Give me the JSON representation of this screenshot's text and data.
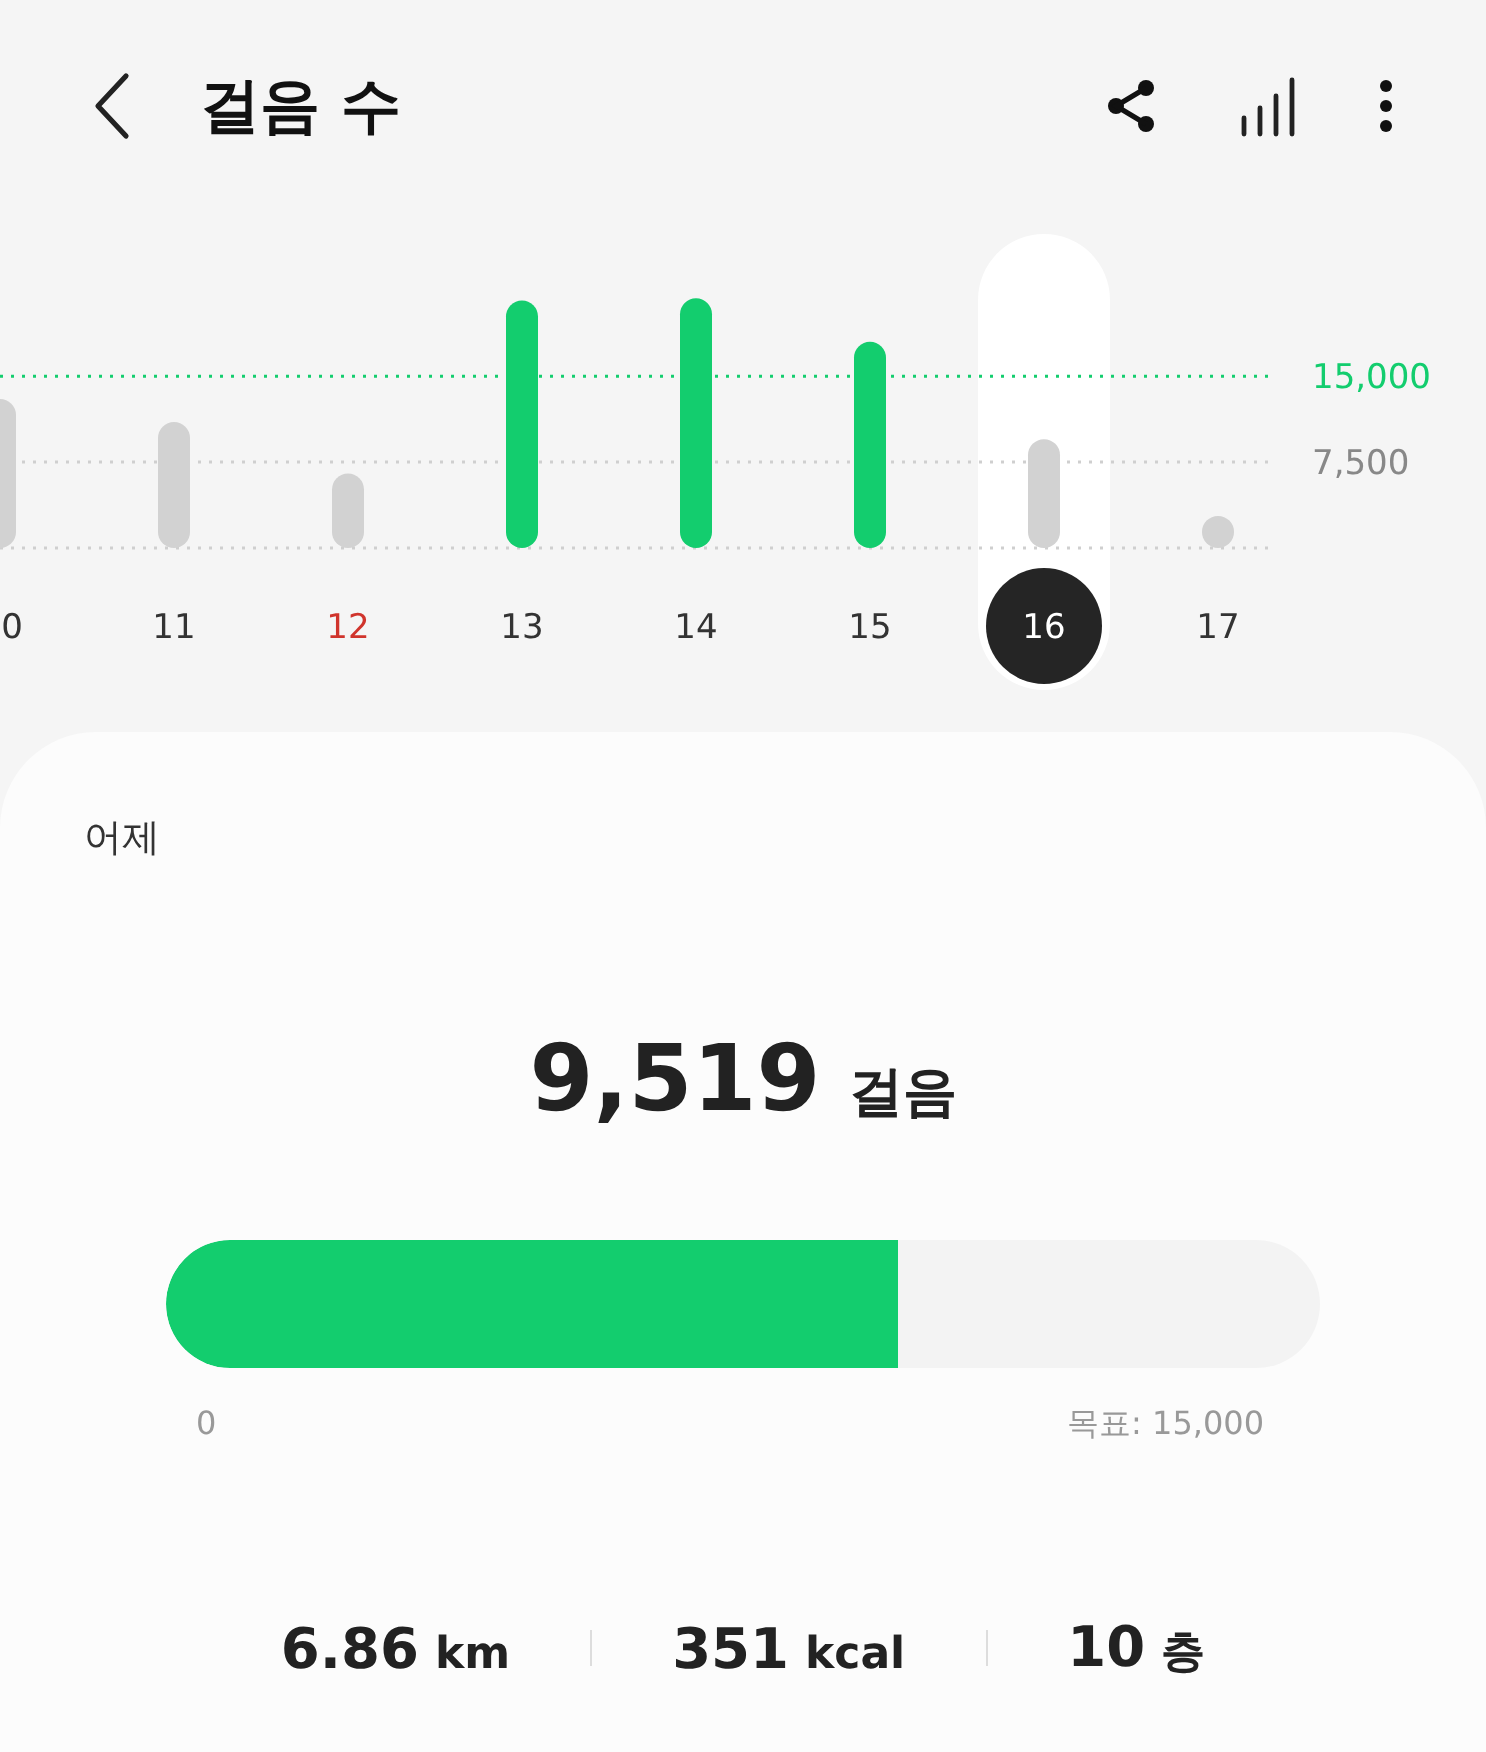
{
  "header": {
    "title": "걸음 수"
  },
  "chart": {
    "chart_data": {
      "type": "bar",
      "categories": [
        "0",
        "11",
        "12",
        "13",
        "14",
        "15",
        "16",
        "17"
      ],
      "series": [
        {
          "color": "#13cd6e",
          "values": [
            null,
            null,
            null,
            21600,
            21800,
            18000,
            null,
            null
          ]
        },
        {
          "color": "#d2d2d2",
          "values": [
            13000,
            11000,
            6500,
            null,
            null,
            null,
            9500,
            2800
          ]
        }
      ],
      "ylim": [
        0,
        22000
      ],
      "yticks": [
        {
          "value": 7500,
          "label": "7,500"
        },
        {
          "value": 15000,
          "label": "15,000"
        }
      ]
    },
    "days": [
      {
        "selected": false,
        "sunday": false
      },
      {
        "selected": false,
        "sunday": false
      },
      {
        "selected": false,
        "sunday": true
      },
      {
        "selected": false,
        "sunday": false
      },
      {
        "selected": false,
        "sunday": false
      },
      {
        "selected": false,
        "sunday": false
      },
      {
        "selected": true,
        "sunday": false
      },
      {
        "selected": false,
        "sunday": false
      }
    ]
  },
  "summary": {
    "day_label": "어제",
    "steps": "9,519",
    "steps_unit": "걸음",
    "progress": {
      "level": 0.635,
      "min_label": "0",
      "goal_label": "목표: 15,000"
    },
    "stats": [
      {
        "value": "6.86",
        "unit": "km"
      },
      {
        "value": "351",
        "unit": "kcal"
      },
      {
        "value": "10",
        "unit": "층"
      }
    ]
  }
}
